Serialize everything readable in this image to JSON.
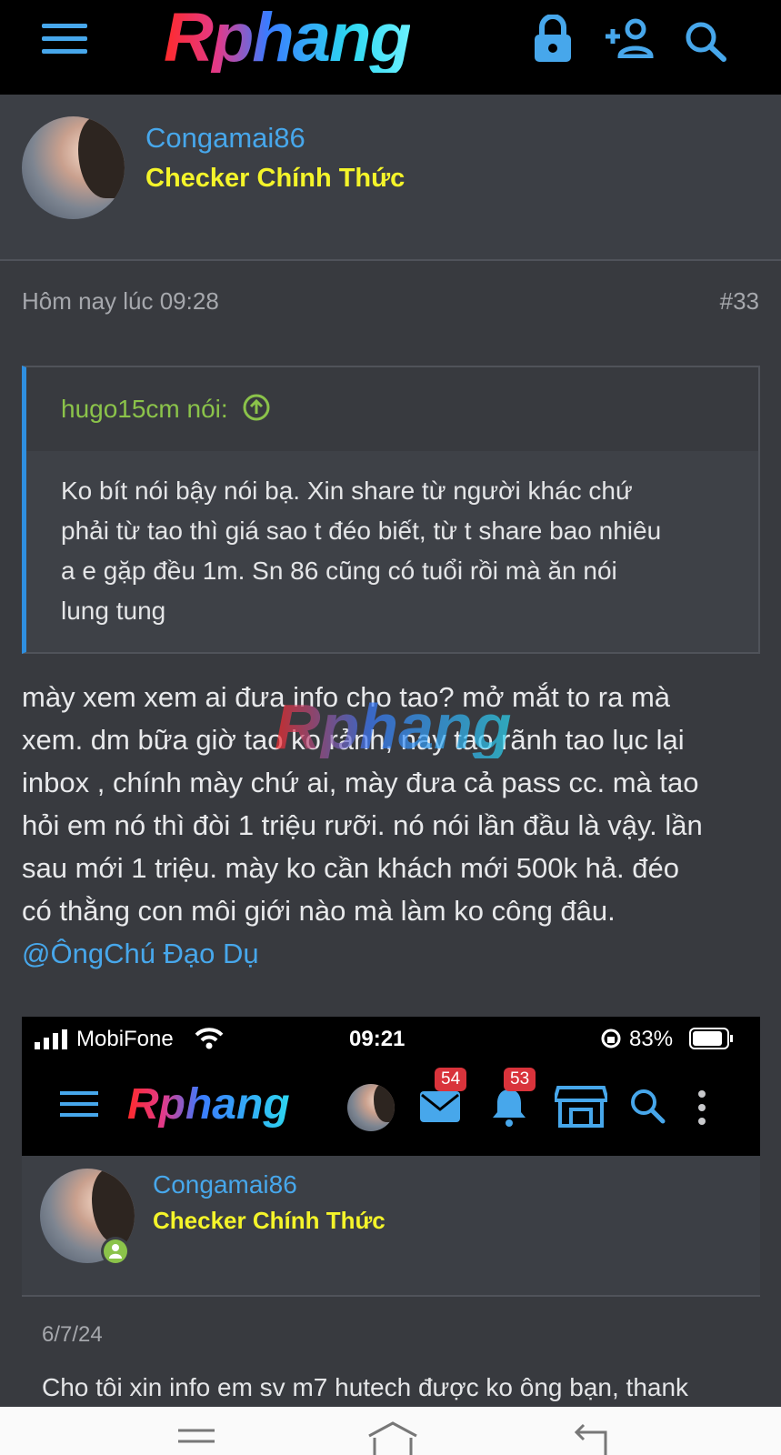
{
  "header": {
    "logo_text": "Rphang",
    "icons": [
      "menu-icon",
      "lock-icon",
      "add-user-icon",
      "search-icon"
    ]
  },
  "profile": {
    "username": "Congamai86",
    "user_title": "Checker Chính Thức"
  },
  "post_meta": {
    "date": "Hôm nay lúc 09:28",
    "post_number": "#33"
  },
  "quote": {
    "author_label": "hugo15cm nói:",
    "lines": [
      "Ko bít nói bậy nói bạ. Xin share từ người khác chứ",
      "phải từ tao thì giá sao t đéo biết, từ t share bao nhiêu",
      "a e gặp đều 1m. Sn 86 cũng có tuổi rồi mà ăn nói",
      "lung tung"
    ]
  },
  "post": {
    "lines": [
      "mày xem xem ai đưa info cho tao? mở mắt to ra mà",
      "xem. dm bữa giờ tao ko rảnh, nay tao rãnh tao lục lại",
      "inbox , chính mày chứ ai, mày đưa cả pass cc. mà tao",
      "hỏi em nó thì đòi 1 triệu rưỡi. nó nói lần đầu là vậy. lần",
      "sau mới 1 triệu. mày ko cần khách mới 500k hả. đéo",
      "có thằng con môi giới nào mà làm ko công đâu."
    ],
    "mention": "@ÔngChú Đạo Dụ",
    "watermark": "Rphang"
  },
  "embedded_screenshot": {
    "carrier": "MobiFone",
    "time": "09:21",
    "battery": "83%",
    "logo_text": "Rphang",
    "messages_badge": "54",
    "notifications_badge": "53",
    "username": "Congamai86",
    "user_title": "Checker Chính Thức",
    "date": "6/7/24",
    "text": "Cho tôi xin info em sv m7 hutech được ko ông bạn, thank"
  },
  "colors": {
    "accent_blue": "#47a7eb",
    "title_yellow": "#f4f42a",
    "quote_green": "#8bc34a",
    "badge_red": "#d9333b"
  }
}
